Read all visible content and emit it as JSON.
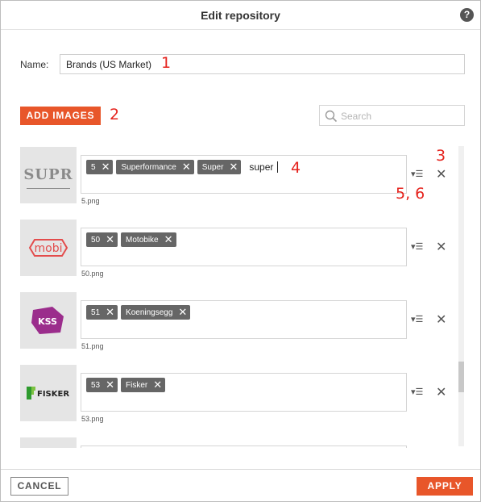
{
  "dialog": {
    "title": "Edit repository",
    "help_icon": "?"
  },
  "name_field": {
    "label": "Name:",
    "value": "Brands (US Market)"
  },
  "toolbar": {
    "add_images_label": "ADD IMAGES",
    "search_placeholder": "Search"
  },
  "annotations": {
    "n1": "1",
    "n2": "2",
    "n3": "3",
    "n4": "4",
    "n56": "5, 6"
  },
  "images": [
    {
      "logo_text": "SUPR",
      "filename": "5.png",
      "tags": [
        "5",
        "Superformance",
        "Super"
      ],
      "input_text": "super"
    },
    {
      "logo_text": "mobi",
      "filename": "50.png",
      "tags": [
        "50",
        "Motobike"
      ]
    },
    {
      "logo_text": "KSS",
      "filename": "51.png",
      "tags": [
        "51",
        "Koeningsegg"
      ]
    },
    {
      "logo_text": "FISKER",
      "filename": "53.png",
      "tags": [
        "53",
        "Fisker"
      ]
    }
  ],
  "icons": {
    "tag_remove": "close-icon",
    "row_menu": "menu-icon",
    "row_close": "close-icon",
    "search": "search-icon"
  },
  "footer": {
    "cancel_label": "CANCEL",
    "apply_label": "APPLY"
  },
  "colors": {
    "accent": "#e8562a",
    "annotation": "#e5231d",
    "tag_bg": "#666666",
    "mobi_logo": "#e34c4c",
    "kss_logo": "#9b2d8c",
    "fisker_logo": "#2e9b2e"
  }
}
